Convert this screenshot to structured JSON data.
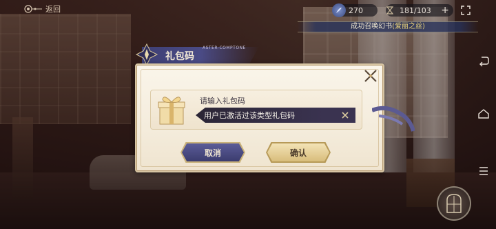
{
  "topbar": {
    "back_label": "返回",
    "feather_value": "270",
    "stamina_value": "181/103",
    "plus_glyph": "+"
  },
  "ticker": {
    "prefix": "成功召唤",
    "highlight": "",
    "middle": "幻书",
    "suffix": "(爱丽之丝)"
  },
  "dialog": {
    "header_title": "礼包码",
    "header_sub": "ASTER-COMPTONE",
    "field_label": "请输入礼包码",
    "field_value": "用户已激活过该类型礼包码",
    "cancel_label": "取消",
    "confirm_label": "确认"
  },
  "colors": {
    "cancel_bg": "#4b4c84",
    "confirm_bg": "#e6cf96",
    "dialog_bg": "#f6efe1",
    "field_bg": "#2f2a3c"
  },
  "icons": [
    "back-ornament-icon",
    "feather-icon",
    "hourglass-icon",
    "plus-icon",
    "fullscreen-icon",
    "gift-box-icon",
    "clear-x-icon",
    "close-x-icon",
    "nav-back-icon",
    "nav-home-icon",
    "nav-recents-icon",
    "window-emblem-icon"
  ]
}
